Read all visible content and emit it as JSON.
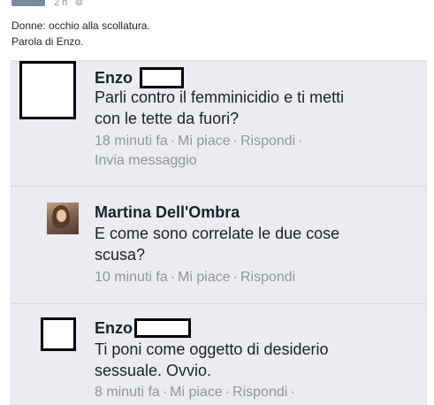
{
  "post": {
    "time": "2 h",
    "lines": [
      "Donne: occhio alla scollatura.",
      "Parola di Enzo."
    ]
  },
  "comments": [
    {
      "name": "Enzo",
      "text": [
        "Parli contro il femminicidio e ti metti",
        "con le tette da fuori?"
      ],
      "time": "18 minuti fa",
      "like": "Mi piace",
      "reply": "Rispondi",
      "message": "Invia messaggio"
    },
    {
      "name": "Martina Dell'Ombra",
      "text": [
        "E come sono correlate le due cose",
        "scusa?"
      ],
      "time": "10 minuti fa",
      "like": "Mi piace",
      "reply": "Rispondi"
    },
    {
      "name": "Enzo",
      "text": [
        "Ti poni come oggetto di desiderio",
        "sessuale. Ovvio."
      ],
      "time": "8 minuti fa",
      "like": "Mi piace",
      "reply": "Rispondi"
    }
  ],
  "icons": {
    "globe": "globe-icon"
  },
  "colors": {
    "meta": "#90949c",
    "name": "#1d2129",
    "thread_bg": "#ebecef"
  }
}
